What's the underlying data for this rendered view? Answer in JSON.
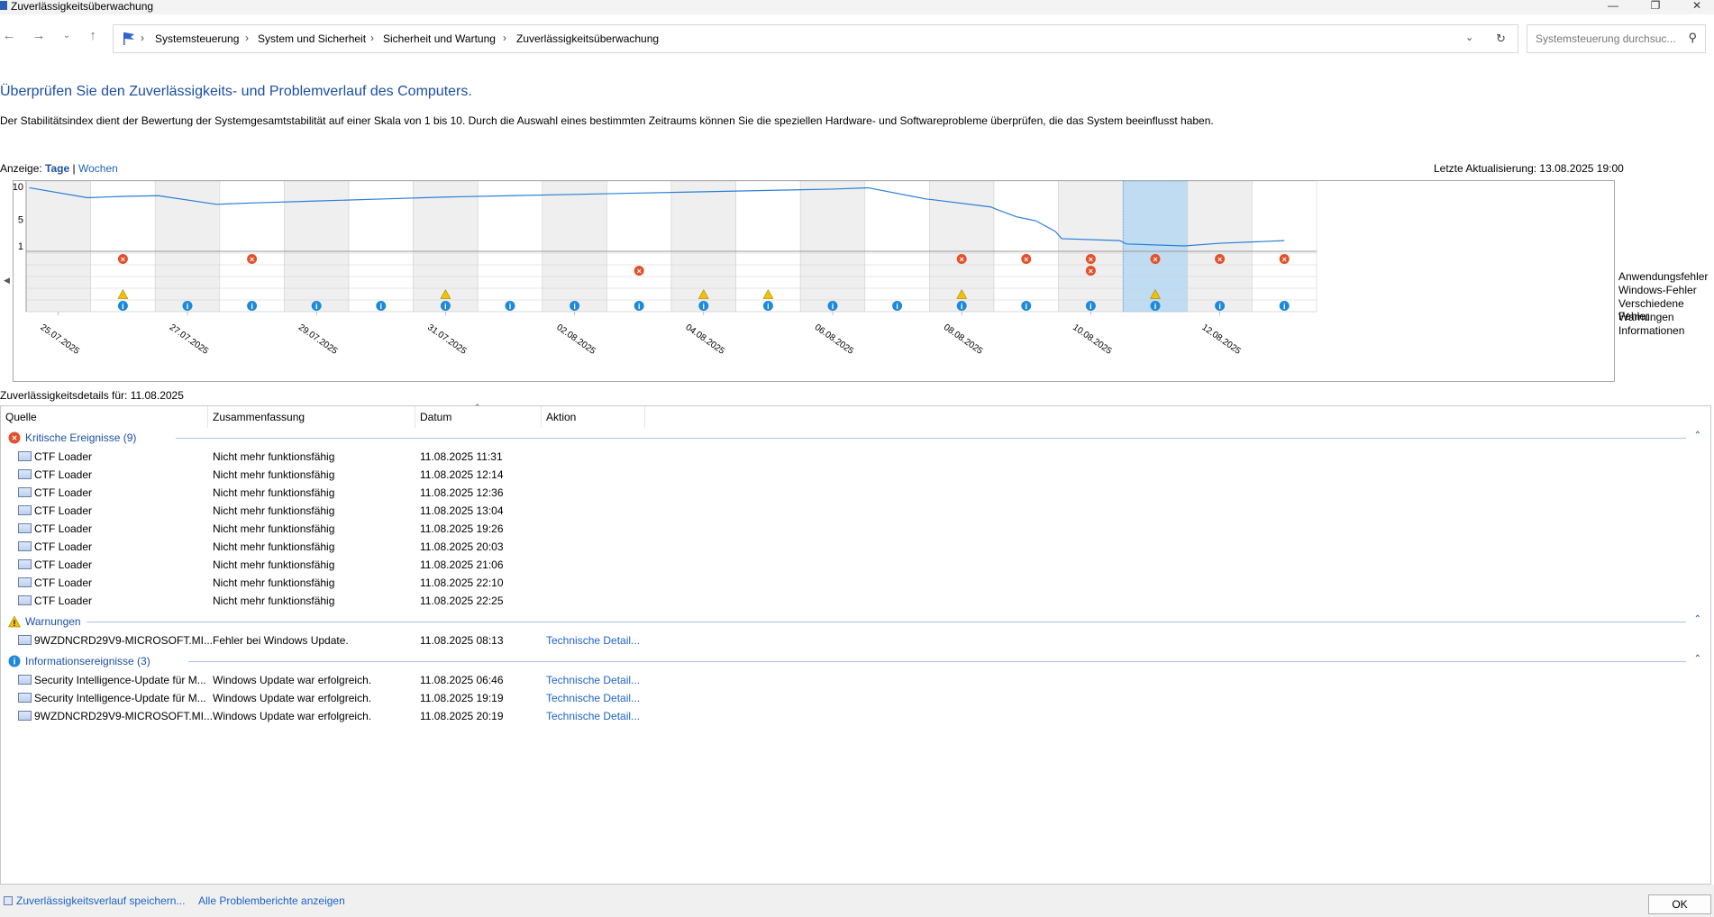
{
  "window": {
    "title": "Zuverlässigkeitsüberwachung"
  },
  "nav": {
    "breadcrumbs": [
      "Systemsteuerung",
      "System und Sicherheit",
      "Sicherheit und Wartung",
      "Zuverlässigkeitsüberwachung"
    ],
    "search_placeholder": "Systemsteuerung durchsuc..."
  },
  "page": {
    "heading": "Überprüfen Sie den Zuverlässigkeits- und Problemverlauf des Computers.",
    "description": "Der Stabilitätsindex dient der Bewertung der Systemgesamtstabilität auf einer Skala von 1 bis 10. Durch die Auswahl eines bestimmten Zeitraums können Sie die speziellen Hardware- und Softwareprobleme überprüfen, die das System beeinflusst haben.",
    "view_label": "Anzeige:",
    "view_days": "Tage",
    "view_sep": "|",
    "view_weeks": "Wochen",
    "last_update": "Letzte Aktualisierung: 13.08.2025 19:00",
    "details_label": "Zuverlässigkeitsdetails für: 11.08.2025"
  },
  "chart_data": {
    "type": "line",
    "y_ticks": [
      "10",
      "5",
      "1"
    ],
    "ylim": [
      1,
      10
    ],
    "selected_column": 17,
    "x_labels": [
      "25.07.2025",
      "27.07.2025",
      "29.07.2025",
      "31.07.2025",
      "02.08.2025",
      "04.08.2025",
      "06.08.2025",
      "08.08.2025",
      "10.08.2025",
      "12.08.2025"
    ],
    "legend": [
      "Anwendungsfehler",
      "Windows-Fehler",
      "Verschiedene Fehler",
      "Warnungen",
      "Informationen"
    ],
    "stability_series": [
      {
        "col": 1,
        "values": [
          9.8,
          8.3
        ]
      },
      {
        "col": 2,
        "values": [
          8.5
        ]
      },
      {
        "col": 3,
        "values": [
          8.6,
          7.3
        ]
      },
      {
        "col": 4,
        "values": [
          7.5
        ]
      },
      {
        "col": 5,
        "values": [
          7.8
        ]
      },
      {
        "col": 6,
        "values": [
          8.1
        ]
      },
      {
        "col": 7,
        "values": [
          8.4
        ]
      },
      {
        "col": 8,
        "values": [
          8.6
        ]
      },
      {
        "col": 9,
        "values": [
          8.8
        ]
      },
      {
        "col": 10,
        "values": [
          9.0
        ]
      },
      {
        "col": 11,
        "values": [
          9.2
        ]
      },
      {
        "col": 12,
        "values": [
          9.4
        ]
      },
      {
        "col": 13,
        "values": [
          9.6
        ]
      },
      {
        "col": 14,
        "values": [
          9.8,
          8.1
        ]
      },
      {
        "col": 15,
        "values": [
          8.0,
          6.9
        ]
      },
      {
        "col": 16,
        "values": [
          6.5,
          5.4,
          4.8,
          3.2
        ]
      },
      {
        "col": 17,
        "values": [
          2.1,
          1.8
        ]
      },
      {
        "col": 18,
        "values": [
          1.3,
          1.0
        ]
      },
      {
        "col": 19,
        "values": [
          1.4
        ]
      },
      {
        "col": 20,
        "values": [
          1.8
        ]
      }
    ],
    "events": {
      "app_errors": [
        1,
        3,
        14,
        15,
        16,
        17,
        18,
        19
      ],
      "windows_errors": [
        9,
        16
      ],
      "misc_errors": [],
      "warnings": [
        1,
        6,
        10,
        11,
        14,
        17
      ],
      "info": [
        1,
        2,
        3,
        4,
        5,
        6,
        7,
        8,
        9,
        10,
        11,
        12,
        13,
        14,
        15,
        16,
        17,
        18,
        19
      ]
    }
  },
  "list": {
    "columns": [
      "Quelle",
      "Zusammenfassung",
      "Datum",
      "Aktion"
    ],
    "groups": [
      {
        "title": "Kritische Ereignisse (9)",
        "icon": "error-icon",
        "rows": [
          {
            "source": "CTF Loader",
            "summary": "Nicht mehr funktionsfähig",
            "date": "11.08.2025 11:31",
            "action": ""
          },
          {
            "source": "CTF Loader",
            "summary": "Nicht mehr funktionsfähig",
            "date": "11.08.2025 12:14",
            "action": ""
          },
          {
            "source": "CTF Loader",
            "summary": "Nicht mehr funktionsfähig",
            "date": "11.08.2025 12:36",
            "action": ""
          },
          {
            "source": "CTF Loader",
            "summary": "Nicht mehr funktionsfähig",
            "date": "11.08.2025 13:04",
            "action": ""
          },
          {
            "source": "CTF Loader",
            "summary": "Nicht mehr funktionsfähig",
            "date": "11.08.2025 19:26",
            "action": ""
          },
          {
            "source": "CTF Loader",
            "summary": "Nicht mehr funktionsfähig",
            "date": "11.08.2025 20:03",
            "action": ""
          },
          {
            "source": "CTF Loader",
            "summary": "Nicht mehr funktionsfähig",
            "date": "11.08.2025 21:06",
            "action": ""
          },
          {
            "source": "CTF Loader",
            "summary": "Nicht mehr funktionsfähig",
            "date": "11.08.2025 22:10",
            "action": ""
          },
          {
            "source": "CTF Loader",
            "summary": "Nicht mehr funktionsfähig",
            "date": "11.08.2025 22:25",
            "action": ""
          }
        ]
      },
      {
        "title": "Warnungen",
        "icon": "warning-icon",
        "rows": [
          {
            "source": "9WZDNCRD29V9-MICROSOFT.MI...",
            "summary": "Fehler bei Windows Update.",
            "date": "11.08.2025 08:13",
            "action": "Technische Detail..."
          }
        ]
      },
      {
        "title": "Informationsereignisse (3)",
        "icon": "info-icon",
        "rows": [
          {
            "source": "Security Intelligence-Update für M...",
            "summary": "Windows Update war erfolgreich.",
            "date": "11.08.2025 06:46",
            "action": "Technische Detail..."
          },
          {
            "source": "Security Intelligence-Update für M...",
            "summary": "Windows Update war erfolgreich.",
            "date": "11.08.2025 19:19",
            "action": "Technische Detail..."
          },
          {
            "source": "9WZDNCRD29V9-MICROSOFT.MI...",
            "summary": "Windows Update war erfolgreich.",
            "date": "11.08.2025 20:19",
            "action": "Technische Detail..."
          }
        ]
      }
    ]
  },
  "footer": {
    "save_link": "Zuverlässigkeitsverlauf speichern...",
    "reports_link": "Alle Problemberichte anzeigen",
    "ok_label": "OK"
  },
  "colors": {
    "accent": "#1d4fa3",
    "line": "#2a7fd4",
    "selected": "#bfdcf3",
    "error": "#e3512b",
    "warning": "#f2c200",
    "info": "#1e8ad6"
  }
}
